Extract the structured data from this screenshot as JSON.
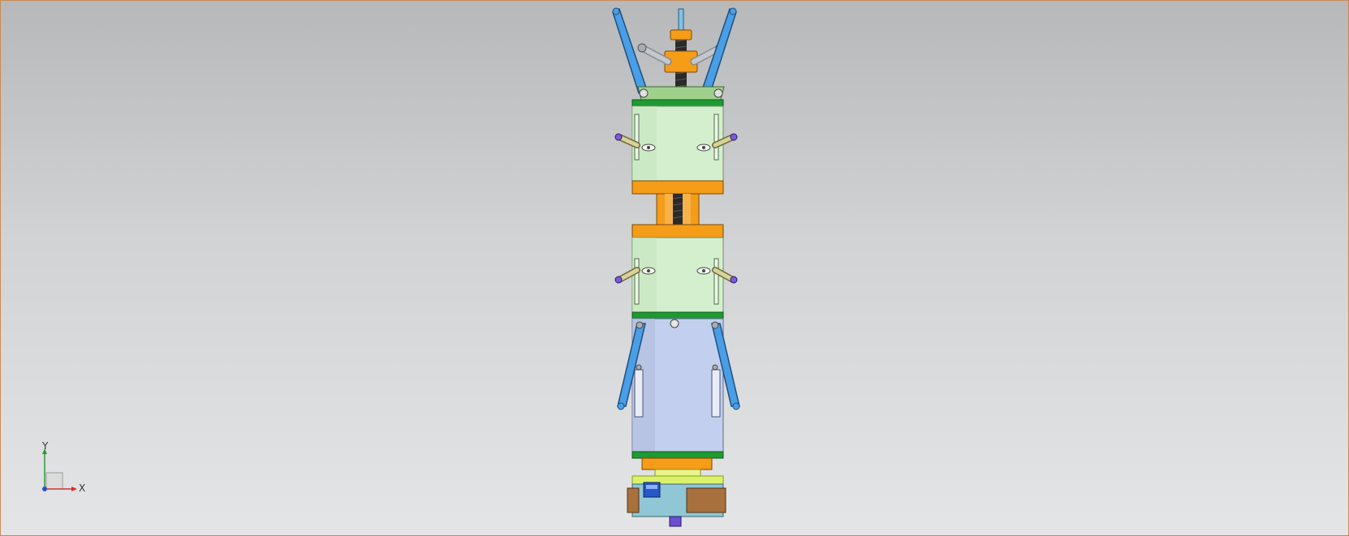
{
  "view": {
    "colors": {
      "background_top": "#b7b8ba",
      "background_bottom": "#e4e5e6",
      "border": "#c98b55",
      "module_green": "#d4efce",
      "module_blue": "#c2cfee",
      "flange_orange": "#f59c18",
      "ring_green": "#1f9a32",
      "arm_blue": "#4a9ee6",
      "base_teal": "#90c7d6",
      "brown_block": "#a8703c",
      "yellow_green": "#dcf16a",
      "pin_purple": "#7a5bd8"
    }
  },
  "triad": {
    "x_label": "X",
    "y_label": "Y",
    "icons": [
      "x-axis-arrow-icon",
      "y-axis-arrow-icon",
      "z-axis-dot-icon",
      "view-cube-icon"
    ]
  }
}
